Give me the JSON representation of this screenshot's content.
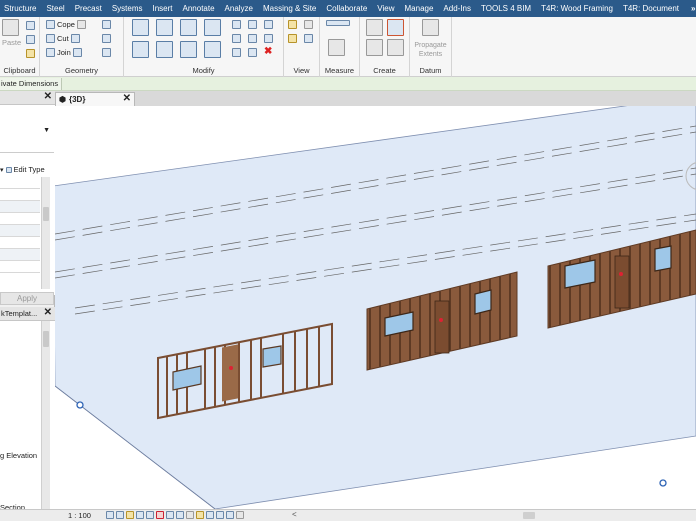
{
  "menu": {
    "tabs": [
      "Structure",
      "Steel",
      "Precast",
      "Systems",
      "Insert",
      "Annotate",
      "Analyze",
      "Massing & Site",
      "Collaborate",
      "View",
      "Manage",
      "Add-Ins",
      "TOOLS 4 BIM",
      "T4R: Wood Framing",
      "T4R: Document"
    ],
    "more": "»"
  },
  "ribbon": {
    "groups": {
      "clipboard": "Clipboard",
      "geometry": "Geometry",
      "modify": "Modify",
      "view": "View",
      "measure": "Measure",
      "create": "Create",
      "datum": "Datum"
    },
    "paste_label": "Paste",
    "cope_label": "Cope",
    "cut_label": "Cut",
    "join_label": "Join",
    "propagate_label": "Propagate",
    "extents_label": "Extents"
  },
  "options_bar": {
    "label": "ivate Dimensions"
  },
  "properties": {
    "edit_type": "Edit Type",
    "apply": "Apply"
  },
  "project_browser": {
    "title": "kTemplat...",
    "item_elevation": "g Elevation",
    "item_section": "Section"
  },
  "view_tab": {
    "label": "{3D}"
  },
  "status": {
    "scale": "1 : 100",
    "left_arrow": "<",
    "left_caret": "›"
  }
}
